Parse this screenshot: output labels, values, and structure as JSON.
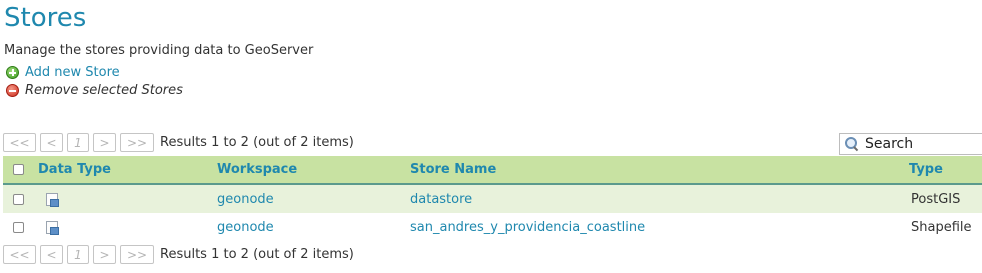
{
  "page": {
    "title": "Stores",
    "description": "Manage the stores providing data to GeoServer"
  },
  "actions": {
    "add_label": "Add new Store",
    "remove_label": "Remove selected Stores"
  },
  "pager": {
    "first": "<<",
    "prev": "<",
    "page": "1",
    "next": ">",
    "last": ">>",
    "results": "Results 1 to 2 (out of 2 items)"
  },
  "search": {
    "placeholder": "Search"
  },
  "table": {
    "headers": {
      "data_type": "Data Type",
      "workspace": "Workspace",
      "store_name": "Store Name",
      "type": "Type"
    },
    "rows": [
      {
        "workspace": "geonode",
        "store_name": "datastore",
        "type": "PostGIS"
      },
      {
        "workspace": "geonode",
        "store_name": "san_andres_y_providencia_coastline",
        "type": "Shapefile"
      }
    ]
  }
}
